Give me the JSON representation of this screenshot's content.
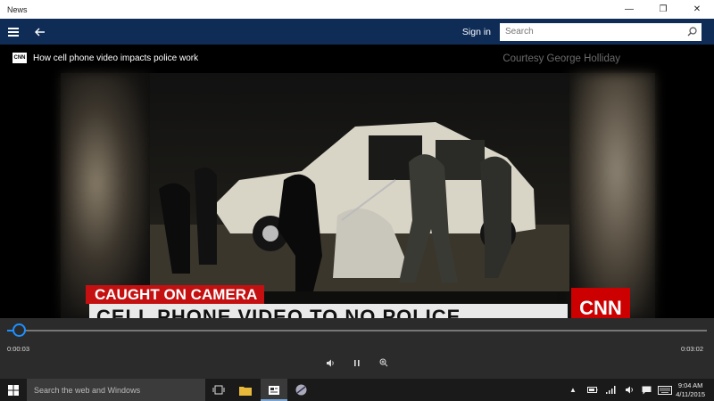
{
  "window": {
    "title": "News",
    "minimize": "—",
    "maximize": "❐",
    "close": "✕"
  },
  "appbar": {
    "sign_in": "Sign in",
    "search_placeholder": "Search"
  },
  "video": {
    "title": "How cell phone video impacts police work",
    "source_badge": "CNN",
    "courtesy": "Courtesy George Holliday",
    "chyron_label": "CAUGHT ON CAMERA",
    "chyron_headline": "CELL PHONE VIDEO TO NO POLICE",
    "network_logo": "CNN"
  },
  "player": {
    "elapsed": "0:00:03",
    "duration": "0:03:02",
    "progress_fraction": 0.0165
  },
  "taskbar": {
    "search_placeholder": "Search the web and Windows",
    "time": "9:04 AM",
    "date": "4/11/2015"
  }
}
